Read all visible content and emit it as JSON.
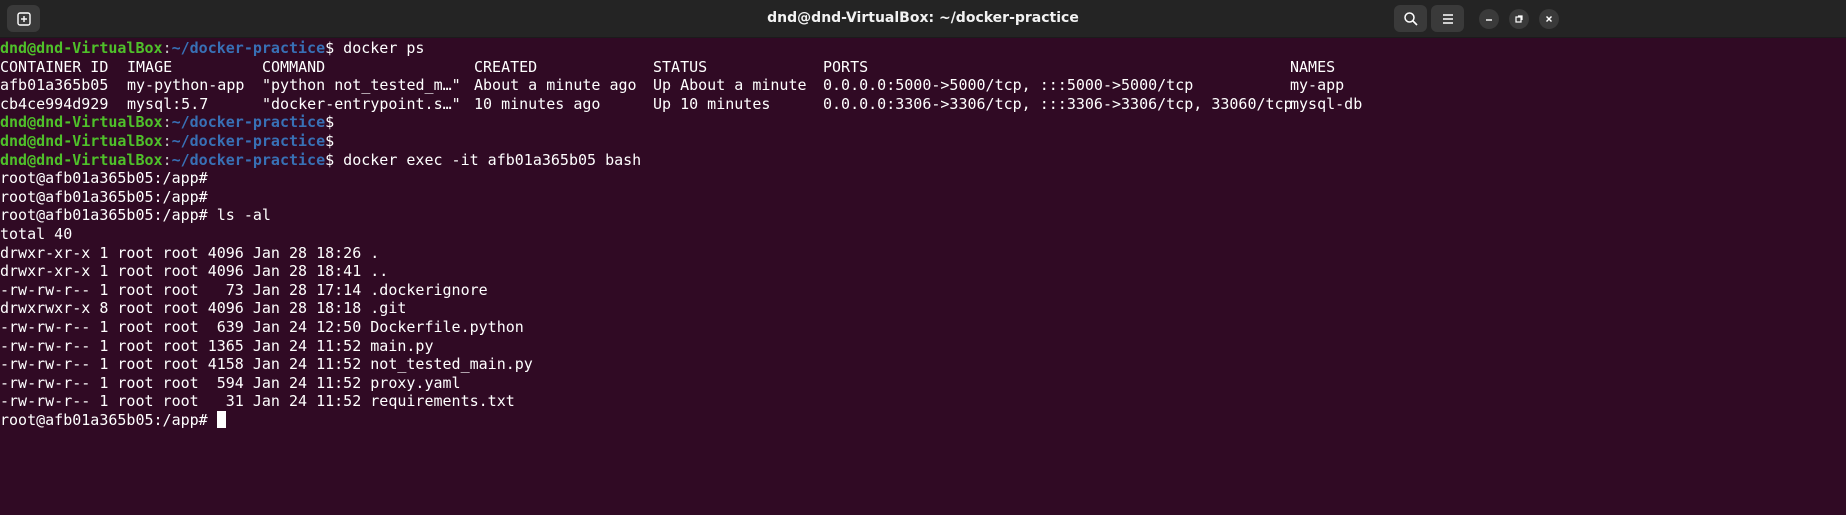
{
  "window": {
    "title": "dnd@dnd-VirtualBox: ~/docker-practice",
    "icons": [
      "new-tab-icon",
      "search-icon",
      "menu-icon",
      "minimize-icon",
      "restore-icon",
      "close-icon"
    ]
  },
  "colors": {
    "background": "#300a24",
    "prompt_user": "#4fc02a",
    "prompt_path": "#3870b5",
    "text": "#ffffff"
  },
  "prompt": {
    "user": "dnd@dnd-VirtualBox",
    "colon": ":",
    "path": "~/docker-practice",
    "sign": "$"
  },
  "root_prompt": "root@afb01a365b05:/app#",
  "commands": {
    "docker_ps": " docker ps",
    "docker_exec": " docker exec -it afb01a365b05 bash",
    "ls": " ls -al"
  },
  "docker_ps": {
    "headers": [
      "CONTAINER ID",
      "IMAGE",
      "COMMAND",
      "CREATED",
      "STATUS",
      "PORTS",
      "NAMES"
    ],
    "rows": [
      [
        "afb01a365b05",
        "my-python-app",
        "\"python not_tested_m…\"",
        "About a minute ago",
        "Up About a minute",
        "0.0.0.0:5000->5000/tcp, :::5000->5000/tcp",
        "my-app"
      ],
      [
        "cb4ce994d929",
        "mysql:5.7",
        "\"docker-entrypoint.s…\"",
        "10 minutes ago",
        "Up 10 minutes",
        "0.0.0.0:3306->3306/tcp, :::3306->3306/tcp, 33060/tcp",
        "mysql-db"
      ]
    ]
  },
  "ls": {
    "total": "total 40",
    "lines": [
      "drwxr-xr-x 1 root root 4096 Jan 28 18:26 .",
      "drwxr-xr-x 1 root root 4096 Jan 28 18:41 ..",
      "-rw-rw-r-- 1 root root   73 Jan 28 17:14 .dockerignore",
      "drwxrwxr-x 8 root root 4096 Jan 28 18:18 .git",
      "-rw-rw-r-- 1 root root  639 Jan 24 12:50 Dockerfile.python",
      "-rw-rw-r-- 1 root root 1365 Jan 24 11:52 main.py",
      "-rw-rw-r-- 1 root root 4158 Jan 24 11:52 not_tested_main.py",
      "-rw-rw-r-- 1 root root  594 Jan 24 11:52 proxy.yaml",
      "-rw-rw-r-- 1 root root   31 Jan 24 11:52 requirements.txt"
    ]
  }
}
